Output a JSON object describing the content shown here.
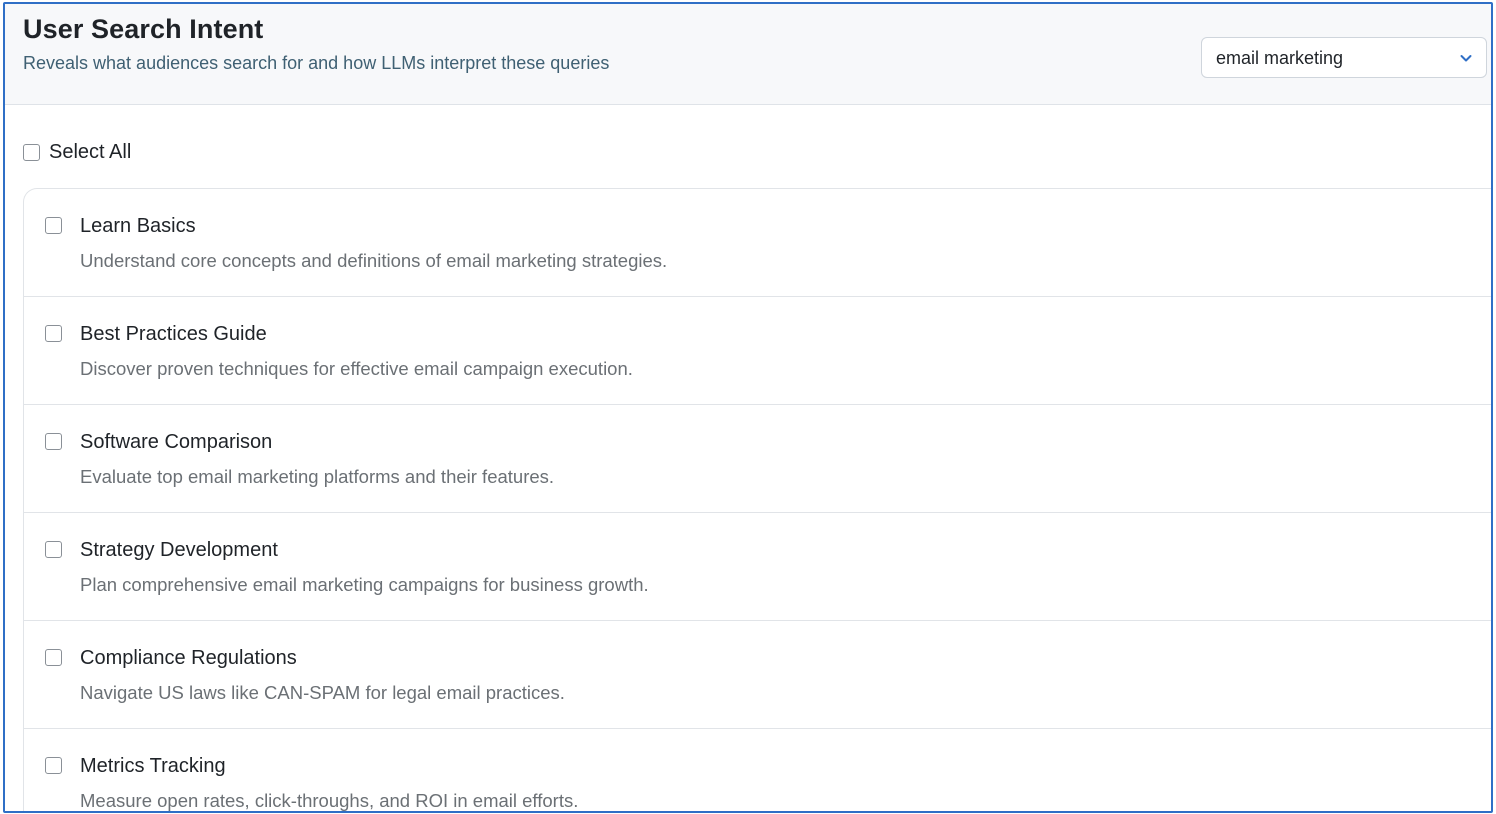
{
  "header": {
    "title": "User Search Intent",
    "subtitle": "Reveals what audiences search for and how LLMs interpret these queries"
  },
  "topic_select": {
    "value": "email marketing",
    "icon": "chevron-down-icon"
  },
  "select_all": {
    "label": "Select All",
    "checked": false
  },
  "intents": [
    {
      "title": "Learn Basics",
      "description": "Understand core concepts and definitions of email marketing strategies.",
      "checked": false
    },
    {
      "title": "Best Practices Guide",
      "description": "Discover proven techniques for effective email campaign execution.",
      "checked": false
    },
    {
      "title": "Software Comparison",
      "description": "Evaluate top email marketing platforms and their features.",
      "checked": false
    },
    {
      "title": "Strategy Development",
      "description": "Plan comprehensive email marketing campaigns for business growth.",
      "checked": false
    },
    {
      "title": "Compliance Regulations",
      "description": "Navigate US laws like CAN-SPAM for legal email practices.",
      "checked": false
    },
    {
      "title": "Metrics Tracking",
      "description": "Measure open rates, click-throughs, and ROI in email efforts.",
      "checked": false
    }
  ],
  "colors": {
    "frame_border": "#2f6fc6",
    "header_bg": "#f7f8fa",
    "subtitle_text": "#3f6073",
    "chevron": "#2f6fc6",
    "description_text": "#6b7075"
  }
}
